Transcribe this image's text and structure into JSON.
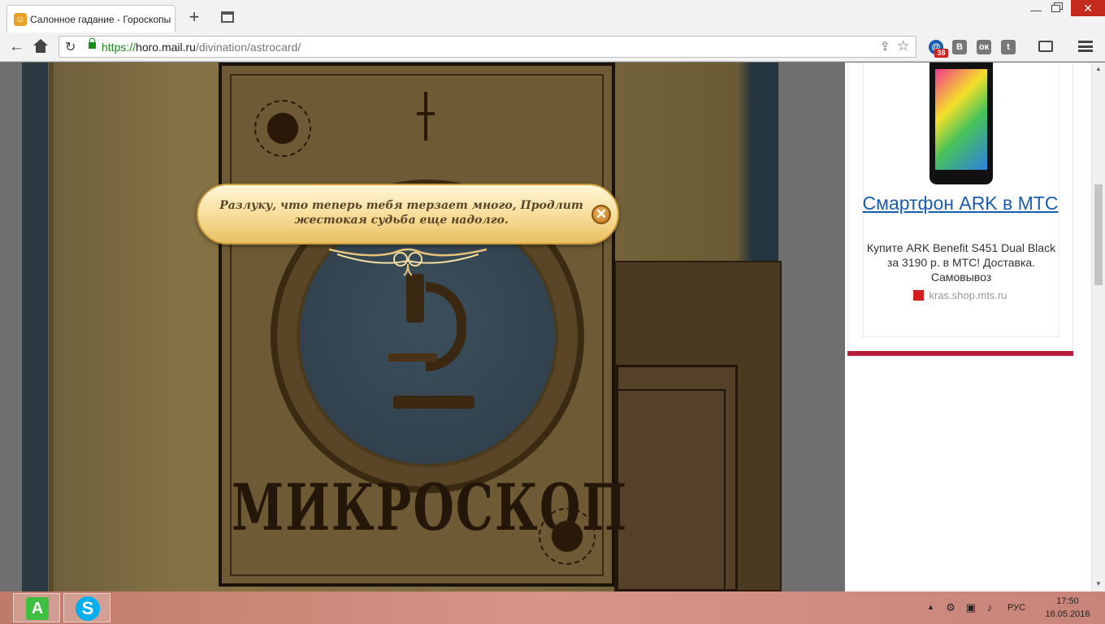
{
  "browser": {
    "tab_title": "Салонное гадание - Гороскопы",
    "tab_favicon": "person-icon",
    "new_tab_symbol": "+",
    "minimize_symbol": "—",
    "close_symbol": "✕",
    "back_symbol": "←",
    "reload_symbol": "↻",
    "url_scheme": "https://",
    "url_host": "horo.mail.ru",
    "url_path": "/divination/astrocard/",
    "share_symbol": "⇪",
    "star_symbol": "☆",
    "extensions": {
      "mail_label": "@",
      "mail_badge": "38",
      "vk_label": "В",
      "ok_label": "ок",
      "twitter_label": "t"
    }
  },
  "game": {
    "card_name": "МИКРОСКОП",
    "popup": {
      "text": "Разлуку, что теперь тебя терзает много, Продлит жестокая судьба еще надолго.",
      "close_symbol": "✕"
    }
  },
  "ad": {
    "title": "Смартфон ARK в МТС",
    "description": "Купите ARK Benefit S451 Dual Black за 3190 р. в МТС! Доставка. Самовывоз",
    "source": "kras.shop.mts.ru",
    "accent_color": "#b71c3a"
  },
  "scrollbar": {
    "up": "▲",
    "down": "▼"
  },
  "taskbar": {
    "apps": [
      {
        "name": "aseko",
        "label": "A"
      },
      {
        "name": "skype",
        "label": "S"
      }
    ],
    "tray_arrow": "▲",
    "tray_icons": [
      "network-icon",
      "monitor-icon",
      "volume-icon"
    ],
    "language": "РУС",
    "time": "17:50",
    "date": "16.05.2016"
  }
}
